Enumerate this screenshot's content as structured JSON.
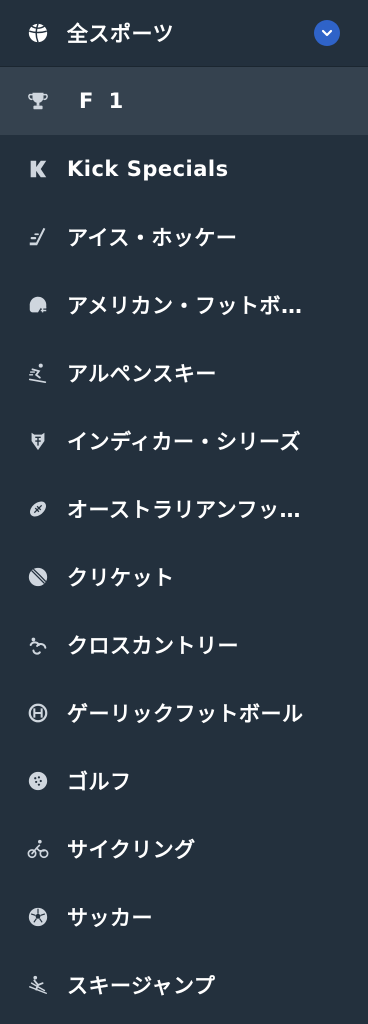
{
  "header": {
    "label": "全スポーツ",
    "icon": "basketball-icon"
  },
  "items": [
    {
      "label": "F 1",
      "icon": "trophy-icon",
      "selected": true
    },
    {
      "label": "Kick Specials",
      "icon": "k-logo-icon"
    },
    {
      "label": "アイス・ホッケー",
      "icon": "hockey-stick-icon"
    },
    {
      "label": "アメリカン・フットボ…",
      "icon": "football-helmet-icon"
    },
    {
      "label": "アルペンスキー",
      "icon": "skier-icon"
    },
    {
      "label": "インディカー・シリーズ",
      "icon": "indycar-badge-icon"
    },
    {
      "label": "オーストラリアンフッ…",
      "icon": "aussie-rules-ball-icon"
    },
    {
      "label": "クリケット",
      "icon": "cricket-ball-icon"
    },
    {
      "label": "クロスカントリー",
      "icon": "cross-country-icon"
    },
    {
      "label": "ゲーリックフットボール",
      "icon": "gaelic-football-icon"
    },
    {
      "label": "ゴルフ",
      "icon": "golf-ball-icon"
    },
    {
      "label": "サイクリング",
      "icon": "cyclist-icon"
    },
    {
      "label": "サッカー",
      "icon": "soccer-ball-icon"
    },
    {
      "label": "スキージャンプ",
      "icon": "ski-jumper-icon"
    }
  ],
  "colors": {
    "background": "#23303d",
    "selected_background": "#35424f",
    "accent": "#2f63c8",
    "icon": "#cfd6de",
    "text": "#ffffff"
  }
}
